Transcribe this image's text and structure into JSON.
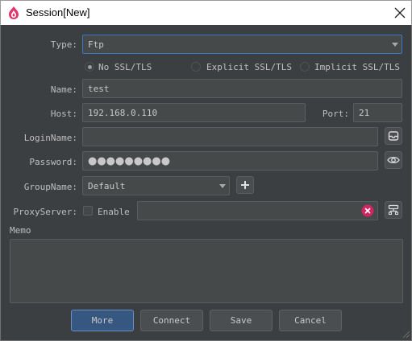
{
  "window": {
    "title": "Session[New]"
  },
  "form": {
    "type": {
      "label": "Type:",
      "value": "Ftp"
    },
    "ssl": {
      "options": [
        "No SSL/TLS",
        "Explicit SSL/TLS",
        "Implicit SSL/TLS"
      ],
      "selected": "No SSL/TLS"
    },
    "name": {
      "label": "Name:",
      "value": "test"
    },
    "host": {
      "label": "Host:",
      "value": "192.168.0.110"
    },
    "port": {
      "label": "Port:",
      "value": "21"
    },
    "login_name": {
      "label": "LoginName:",
      "value": ""
    },
    "password": {
      "label": "Password:",
      "value": "●●●●●●●●●"
    },
    "group_name": {
      "label": "GroupName:",
      "value": "Default"
    },
    "proxy_server": {
      "label": "ProxyServer:",
      "enable_label": "Enable",
      "enabled": false,
      "value": ""
    },
    "memo": {
      "label": "Memo",
      "value": ""
    }
  },
  "buttons": {
    "more": "More",
    "connect": "Connect",
    "save": "Save",
    "cancel": "Cancel"
  },
  "colors": {
    "accent_blue": "#3d76c2",
    "primary_button": "#365880",
    "clear_icon": "#d1255f",
    "logo": "#e0386b"
  },
  "icons": [
    "app-logo-icon",
    "close-icon",
    "chevron-down-icon",
    "inbox-icon",
    "eye-icon",
    "plus-icon",
    "clear-icon",
    "network-icon"
  ]
}
